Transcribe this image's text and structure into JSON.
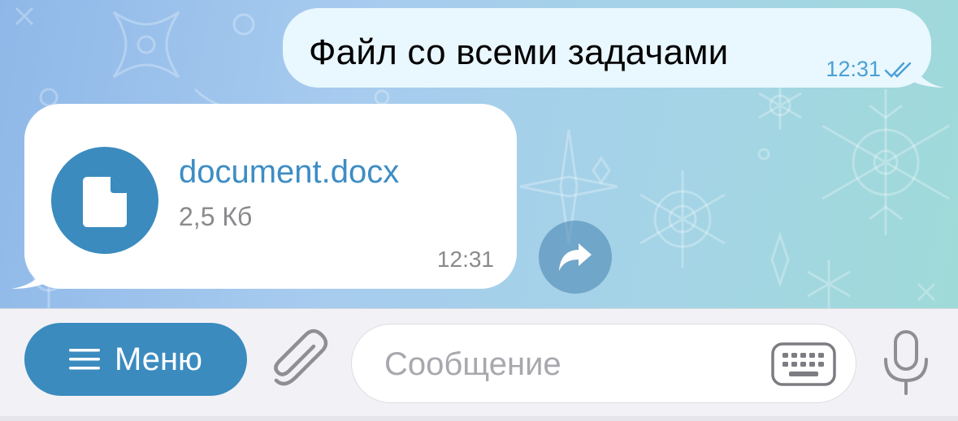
{
  "messages": {
    "outgoing": {
      "text": "Файл со всеми задачами",
      "time": "12:31",
      "status_icon": "double-check-icon"
    },
    "incoming": {
      "file_name": "document.docx",
      "file_size": "2,5 Кб",
      "time": "12:31",
      "icon": "file-icon"
    },
    "share_icon": "share-arrow-icon"
  },
  "composer": {
    "menu_label": "Меню",
    "menu_icon": "hamburger-icon",
    "attach_icon": "paperclip-icon",
    "placeholder": "Сообщение",
    "value": "",
    "keyboard_icon": "keyboard-icon",
    "mic_icon": "microphone-icon"
  },
  "colors": {
    "accent": "#3b8bbf",
    "outgoing_bubble": "#e9f7ff",
    "incoming_bubble": "#ffffff",
    "check_color": "#4a9fd4"
  }
}
